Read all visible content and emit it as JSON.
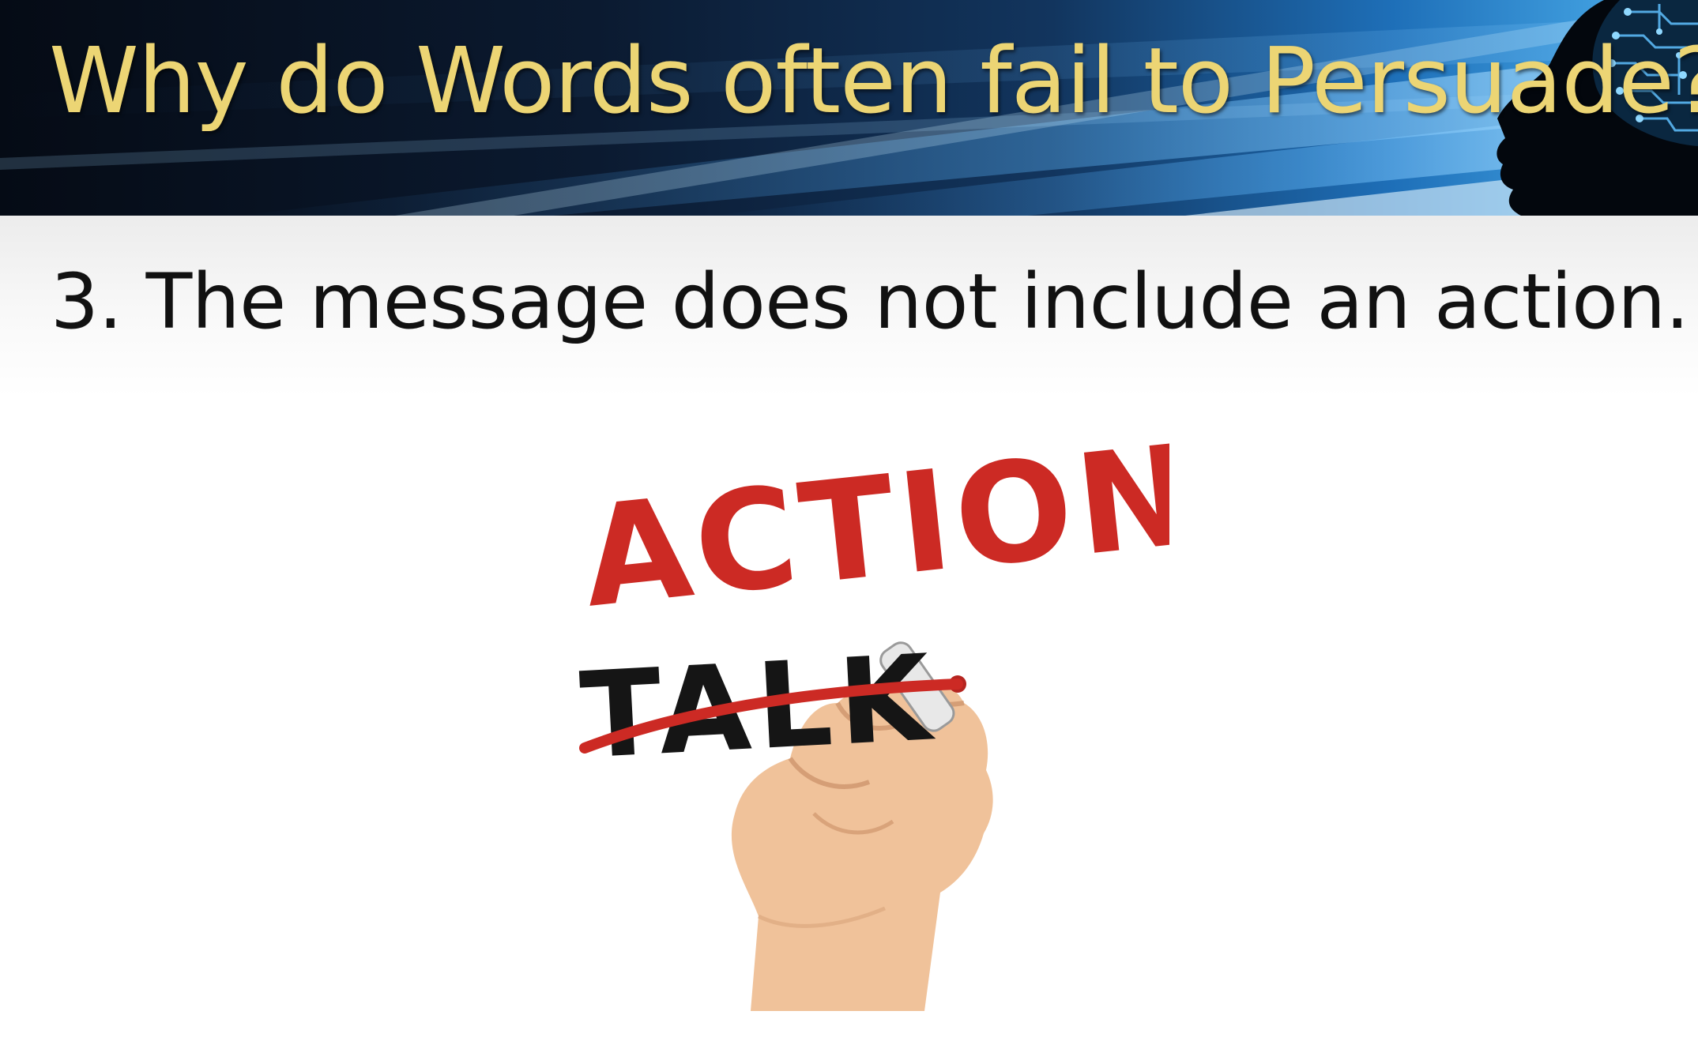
{
  "slide": {
    "title": "Why do Words often fail to Persuade?",
    "bullet": "3. The message does not include an action.",
    "illustration": {
      "primary_word": "ACTION!",
      "crossed_word": "TALK"
    }
  },
  "colors": {
    "title_gold": "#ecd574",
    "banner_dark": "#07111f",
    "banner_blue": "#2f8fdc",
    "action_red": "#cc2a24",
    "talk_black": "#151515"
  },
  "icons": {
    "banner_head": "circuit-head-silhouette-icon",
    "hand": "hand-holding-marker-icon"
  }
}
